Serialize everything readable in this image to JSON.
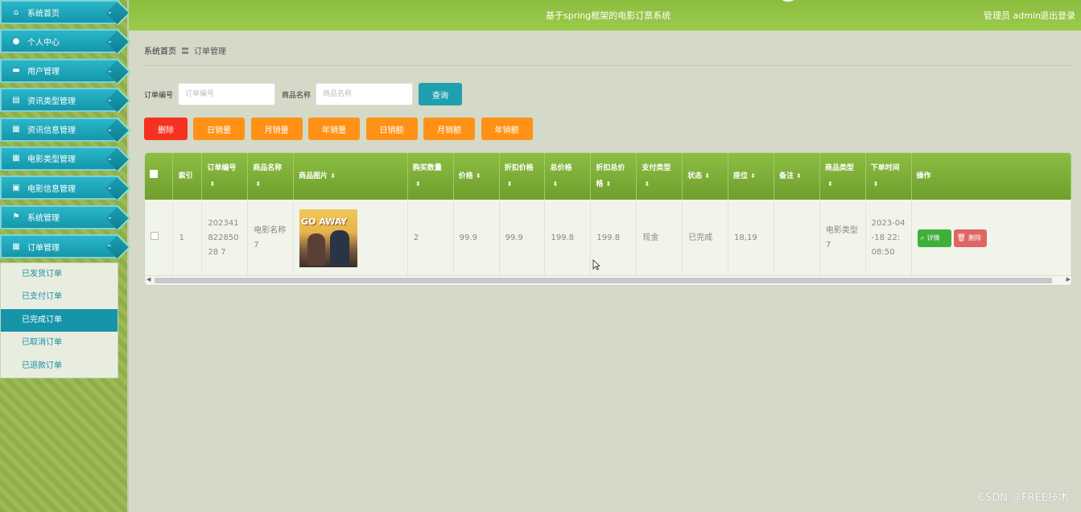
{
  "sidebar": {
    "items": [
      {
        "icon": "home-icon",
        "glyph": "⌂",
        "label": "系统首页"
      },
      {
        "icon": "person-icon",
        "glyph": "●",
        "label": "个人中心"
      },
      {
        "icon": "briefcase-icon",
        "glyph": "▬",
        "label": "用户管理"
      },
      {
        "icon": "print-icon",
        "glyph": "▤",
        "label": "资讯类型管理"
      },
      {
        "icon": "grid-icon",
        "glyph": "▦",
        "label": "资讯信息管理"
      },
      {
        "icon": "grid-icon",
        "glyph": "▦",
        "label": "电影类型管理"
      },
      {
        "icon": "clipboard-icon",
        "glyph": "▣",
        "label": "电影信息管理"
      },
      {
        "icon": "flag-icon",
        "glyph": "⚑",
        "label": "系统管理"
      },
      {
        "icon": "grid-icon",
        "glyph": "▦",
        "label": "订单管理"
      }
    ],
    "submenu": [
      "已发货订单",
      "已支付订单",
      "已完成订单",
      "已取消订单",
      "已退款订单"
    ],
    "active_submenu": "已完成订单"
  },
  "header": {
    "title": "基于spring框架的电影订票系统",
    "user": "管理员 admin",
    "logout": "退出登录"
  },
  "breadcrumb": {
    "home": "系统首页",
    "sep": "〓",
    "current": "订单管理"
  },
  "search": {
    "order_label": "订单编号",
    "order_placeholder": "订单编号",
    "product_label": "商品名称",
    "product_placeholder": "商品名称",
    "query": "查询"
  },
  "actions": {
    "delete": "删除",
    "day_sales": "日销量",
    "month_sales": "月销量",
    "year_sales": "年销量",
    "day_amount": "日销额",
    "month_amount": "月销额",
    "year_amount": "年销额"
  },
  "table": {
    "headers": [
      "索引",
      "订单编号",
      "商品名称",
      "商品图片",
      "购买数量",
      "价格",
      "折扣价格",
      "总价格",
      "折扣总价格",
      "支付类型",
      "状态",
      "座位",
      "备注",
      "商品类型",
      "下单时间",
      "操作"
    ],
    "rows": [
      {
        "index": "1",
        "order_no": "20234182285028 7",
        "product_name": "电影名称7",
        "poster_text": "GO AWAY",
        "quantity": "2",
        "price": "99.9",
        "discount_price": "99.9",
        "total": "199.8",
        "discount_total": "199.8",
        "pay_type": "现金",
        "status": "已完成",
        "seat": "18,19",
        "note": "",
        "product_type": "电影类型7",
        "order_time": "2023-04-18 22:08:50",
        "detail": "详情",
        "delete": "删除"
      }
    ]
  },
  "watermark": "CSDN @FREE技术",
  "colors": {
    "teal": "#1fa0b0",
    "orange": "#ff9216",
    "red": "#f5311f",
    "green_header": "#7eae35"
  }
}
